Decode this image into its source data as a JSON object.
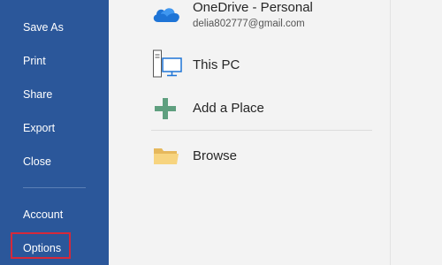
{
  "sidebar": {
    "items": [
      {
        "label": "Save As"
      },
      {
        "label": "Print"
      },
      {
        "label": "Share"
      },
      {
        "label": "Export"
      },
      {
        "label": "Close"
      },
      {
        "label": "Account"
      },
      {
        "label": "Options"
      }
    ],
    "background": "#2b579a",
    "selected_highlight_color": "#d6293a"
  },
  "places": [
    {
      "title": "OneDrive - Personal",
      "subtitle": "delia802777@gmail.com",
      "icon": "cloud-icon"
    },
    {
      "title": "This PC",
      "icon": "computer-icon"
    },
    {
      "title": "Add a Place",
      "icon": "plus-icon"
    },
    {
      "title": "Browse",
      "icon": "folder-icon"
    }
  ]
}
